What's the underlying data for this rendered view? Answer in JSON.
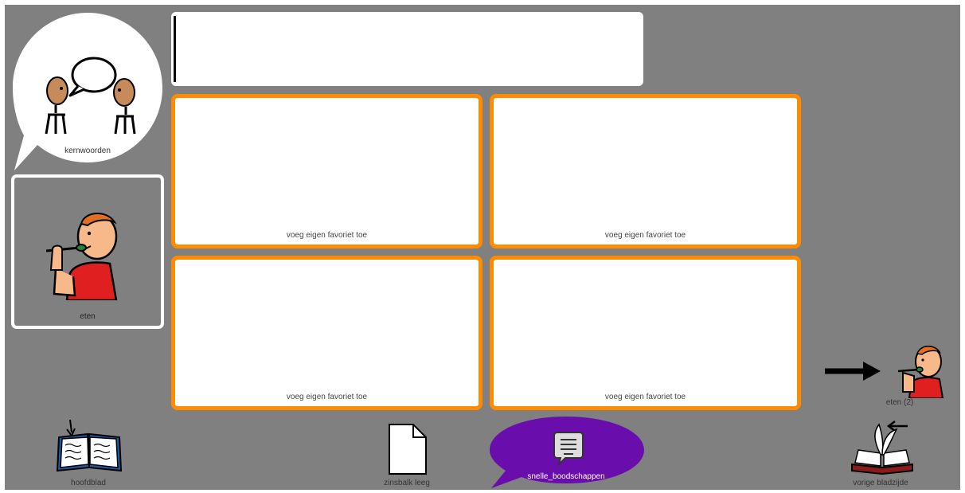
{
  "sentence_bar": {
    "value": ""
  },
  "core_words": {
    "label": "kernwoorden",
    "icon": "two-people-talking-icon"
  },
  "eat_tile": {
    "label": "eten",
    "icon": "person-eating-icon"
  },
  "favorites": [
    {
      "label": "voeg eigen favoriet toe"
    },
    {
      "label": "voeg eigen favoriet toe"
    },
    {
      "label": "voeg eigen favoriet toe"
    },
    {
      "label": "voeg eigen favoriet toe"
    }
  ],
  "next_page": {
    "label": "eten (2)",
    "icon": "arrow-person-eating-icon"
  },
  "bottom_bar": {
    "home": {
      "label": "hoofdblad",
      "icon": "open-book-icon"
    },
    "clear": {
      "label": "zinsbalk leeg",
      "icon": "blank-page-icon"
    },
    "quick": {
      "label": "snelle_boodschappen",
      "icon": "speech-bubble-icon"
    },
    "back": {
      "label": "vorige bladzijde",
      "icon": "turn-page-back-icon"
    }
  },
  "colors": {
    "background": "#808080",
    "favorite_border": "#ff8c00",
    "quick_messages": "#6a0dad"
  }
}
